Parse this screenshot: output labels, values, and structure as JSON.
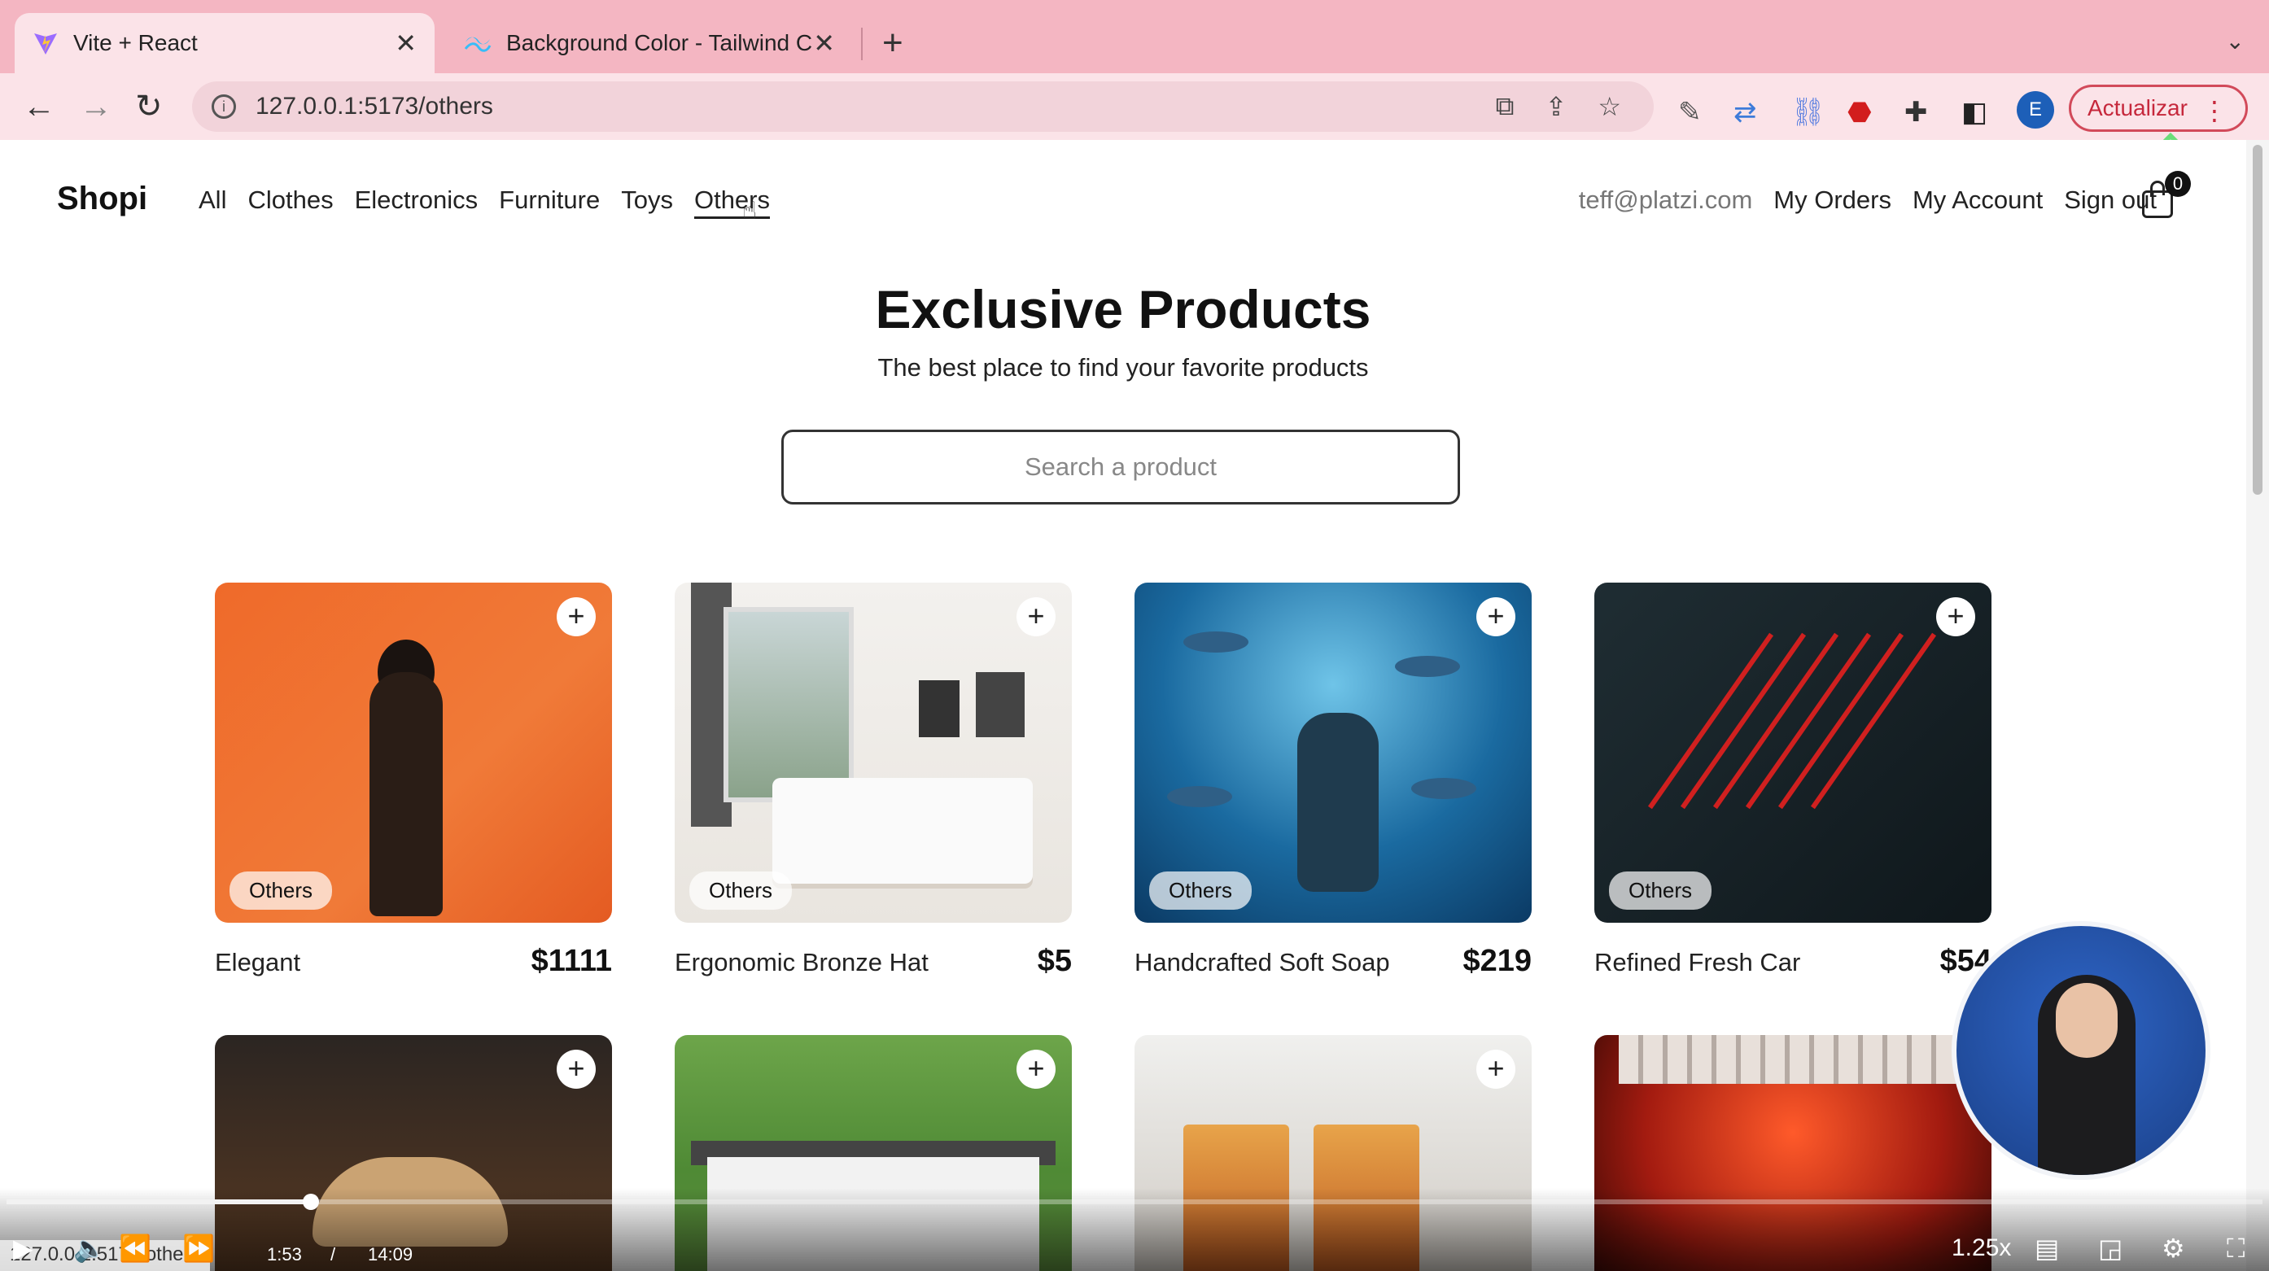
{
  "browser": {
    "tabs": [
      {
        "title": "Vite + React",
        "icon": "vite-logo-icon"
      },
      {
        "title": "Background Color - Tailwind CSS",
        "icon": "tailwind-logo-icon"
      }
    ],
    "url": "127.0.0.1:5173/others",
    "update_label": "Actualizar",
    "profile_initial": "E"
  },
  "app": {
    "brand": "Shopi",
    "nav": [
      "All",
      "Clothes",
      "Electronics",
      "Furniture",
      "Toys",
      "Others"
    ],
    "active_nav": "Others",
    "user_email": "teff@platzi.com",
    "right_nav": [
      "My Orders",
      "My Account",
      "Sign out"
    ],
    "cart_count": "0"
  },
  "hero": {
    "title": "Exclusive Products",
    "subtitle": "The best place to find your favorite products",
    "search_placeholder": "Search a product"
  },
  "products": [
    {
      "name": "Elegant",
      "price": "$1111",
      "category": "Others"
    },
    {
      "name": "Ergonomic Bronze Hat",
      "price": "$5",
      "category": "Others"
    },
    {
      "name": "Handcrafted Soft Soap",
      "price": "$219",
      "category": "Others"
    },
    {
      "name": "Refined Fresh Car",
      "price": "$54",
      "category": "Others"
    }
  ],
  "player": {
    "current_time": "1:53",
    "separator": "/",
    "duration": "14:09",
    "speed": "1.25x",
    "status_url": "127.0.0.1:5173/others",
    "progress_fraction": 0.135
  }
}
